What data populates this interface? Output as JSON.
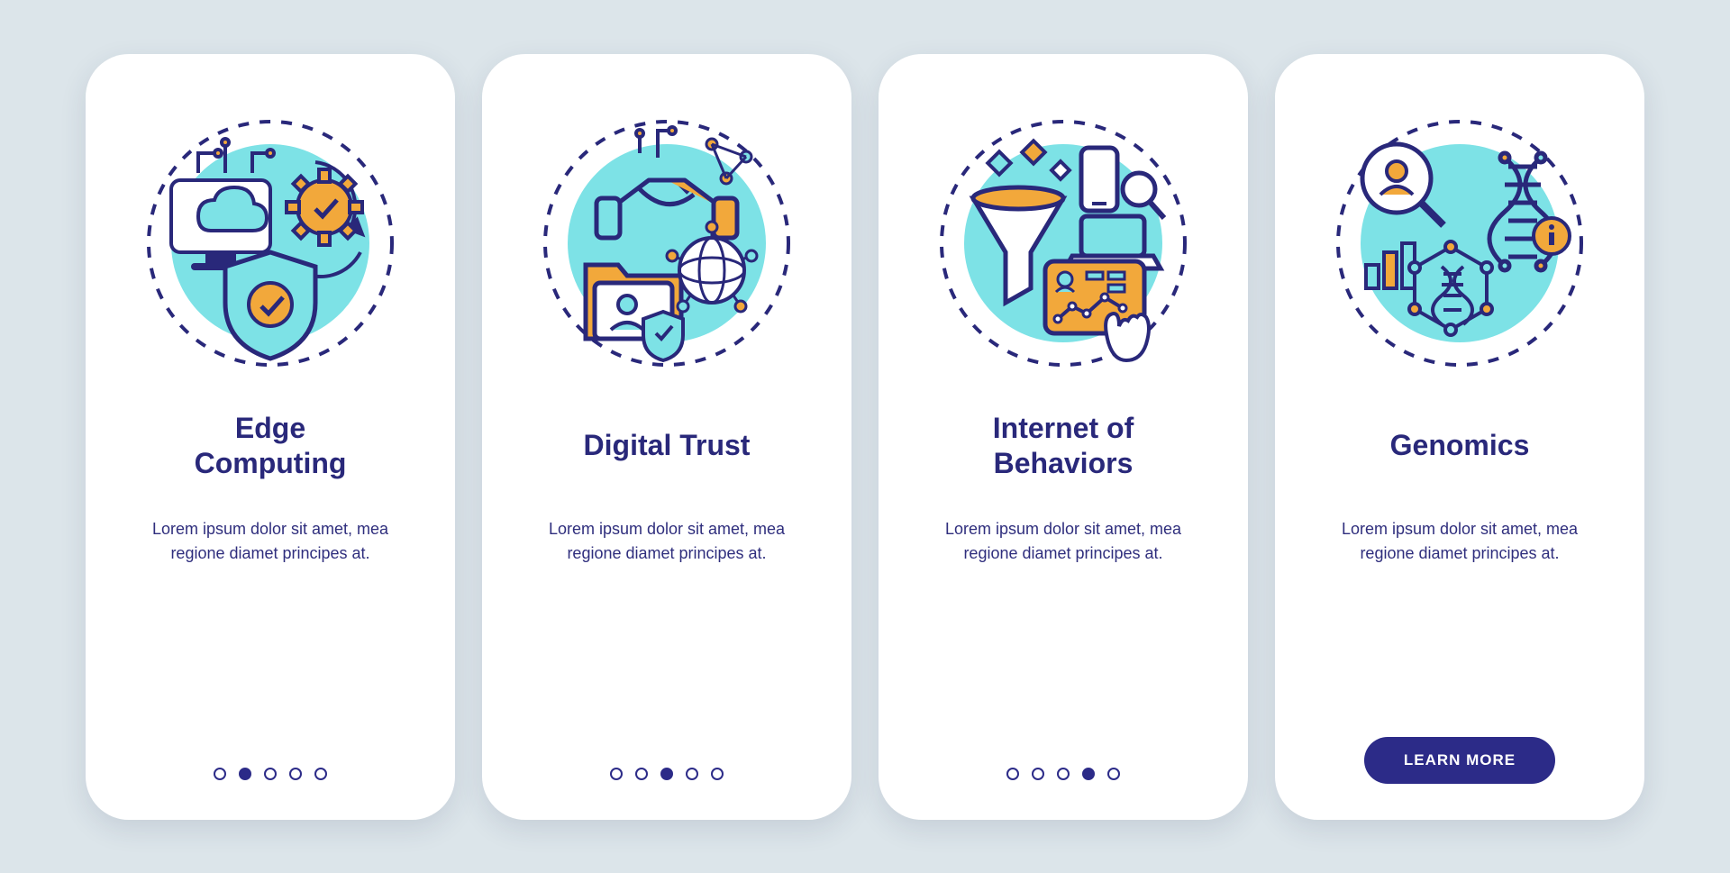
{
  "colors": {
    "navy": "#29287a",
    "cyan": "#7de2e6",
    "orange": "#f2a83b",
    "bg": "#dce5ea",
    "white": "#ffffff"
  },
  "cards": [
    {
      "id": "edge-computing",
      "title": "Edge\nComputing",
      "description": "Lorem ipsum dolor sit amet, mea regione diamet principes at.",
      "pager_total": 5,
      "pager_active": 1,
      "has_button": false,
      "icon": "edge-computing-icon"
    },
    {
      "id": "digital-trust",
      "title": "Digital Trust",
      "description": "Lorem ipsum dolor sit amet, mea regione diamet principes at.",
      "pager_total": 5,
      "pager_active": 2,
      "has_button": false,
      "icon": "digital-trust-icon"
    },
    {
      "id": "internet-of-behaviors",
      "title": "Internet of\nBehaviors",
      "description": "Lorem ipsum dolor sit amet, mea regione diamet principes at.",
      "pager_total": 5,
      "pager_active": 3,
      "has_button": false,
      "icon": "iob-icon"
    },
    {
      "id": "genomics",
      "title": "Genomics",
      "description": "Lorem ipsum dolor sit amet, mea regione diamet principes at.",
      "pager_total": 5,
      "pager_active": 4,
      "has_button": true,
      "button_label": "LEARN MORE",
      "icon": "genomics-icon"
    }
  ]
}
